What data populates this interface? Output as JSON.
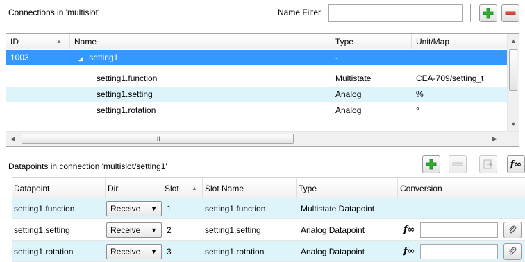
{
  "top": {
    "connections_label": "Connections in 'multislot'",
    "name_filter_label": "Name Filter",
    "name_filter_value": ""
  },
  "connections_table": {
    "columns": [
      "ID",
      "Name",
      "Type",
      "Unit/Map"
    ],
    "rows": [
      {
        "id": "1003",
        "name": "setting1",
        "type": "-",
        "unit": "",
        "expander": "◢"
      },
      {
        "id": "",
        "name": "setting1.function",
        "type": "Multistate",
        "unit": "CEA-709/setting_t"
      },
      {
        "id": "",
        "name": "setting1.setting",
        "type": "Analog",
        "unit": "%"
      },
      {
        "id": "",
        "name": "setting1.rotation",
        "type": "Analog",
        "unit": "°"
      }
    ],
    "hscroll_grip": "III"
  },
  "datapoints": {
    "label": "Datapoints in connection 'multislot/setting1'",
    "columns": [
      "Datapoint",
      "Dir",
      "Slot",
      "Slot Name",
      "Type",
      "Conversion"
    ],
    "rows": [
      {
        "datapoint": "setting1.function",
        "dir": "Receive",
        "slot": "1",
        "slot_name": "setting1.function",
        "type": "Multistate Datapoint",
        "has_conversion": false
      },
      {
        "datapoint": "setting1.setting",
        "dir": "Receive",
        "slot": "2",
        "slot_name": "setting1.setting",
        "type": "Analog Datapoint",
        "has_conversion": true
      },
      {
        "datapoint": "setting1.rotation",
        "dir": "Receive",
        "slot": "3",
        "slot_name": "setting1.rotation",
        "type": "Analog Datapoint",
        "has_conversion": true
      }
    ],
    "fx_label": "f∞"
  },
  "colors": {
    "selection": "#3399ff",
    "alt_row": "#ddf4fb",
    "add_green": "#2fae2f",
    "remove_red": "#e0483b"
  }
}
